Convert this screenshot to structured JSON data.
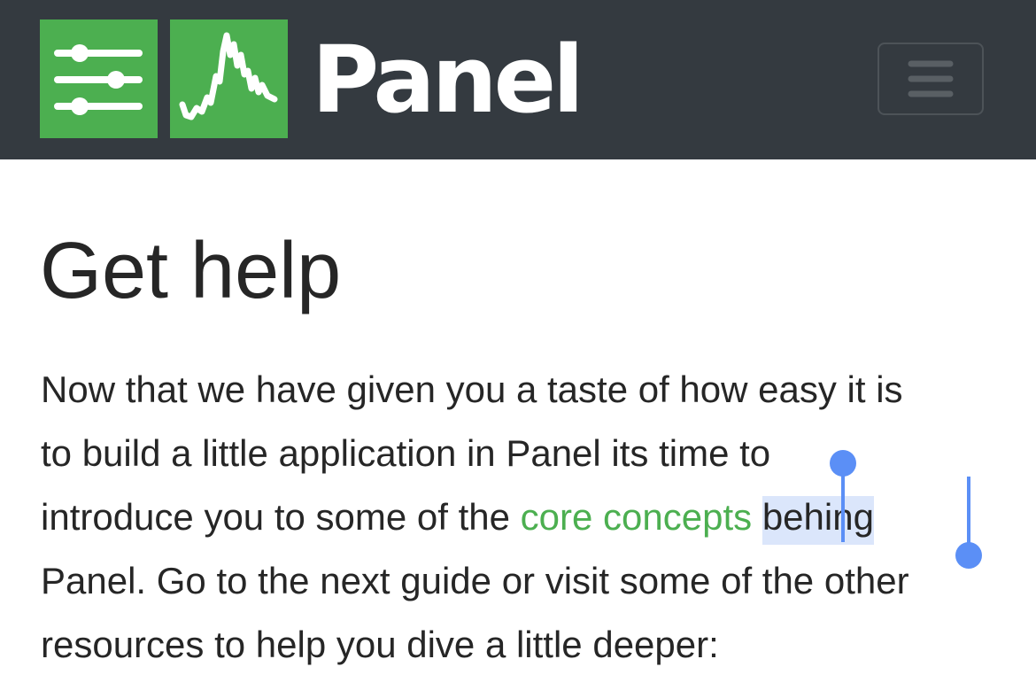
{
  "navbar": {
    "brand": "Panel",
    "logo_icons": [
      "sliders-icon",
      "line-chart-icon"
    ],
    "menu_icon": "hamburger-icon",
    "colors": {
      "background": "#343a40",
      "logo_green": "#4caf50",
      "text": "#ffffff"
    }
  },
  "main": {
    "title": "Get help",
    "paragraph": {
      "line1": "Now that we have given you a taste of how easy it is",
      "line2": "to build a little application in Panel its time to",
      "line3_before": "introduce you to some of the ",
      "line3_link": "core concepts",
      "line3_space": " ",
      "line3_selected": "behing",
      "line4": "Panel. Go to the next guide or visit some of the other",
      "line5": "resources to help you dive a little deeper:"
    },
    "colors": {
      "text": "#262626",
      "link": "#4caf50",
      "selection_highlight": "#dbe6fb",
      "selection_handle": "#5b8ff6"
    }
  }
}
